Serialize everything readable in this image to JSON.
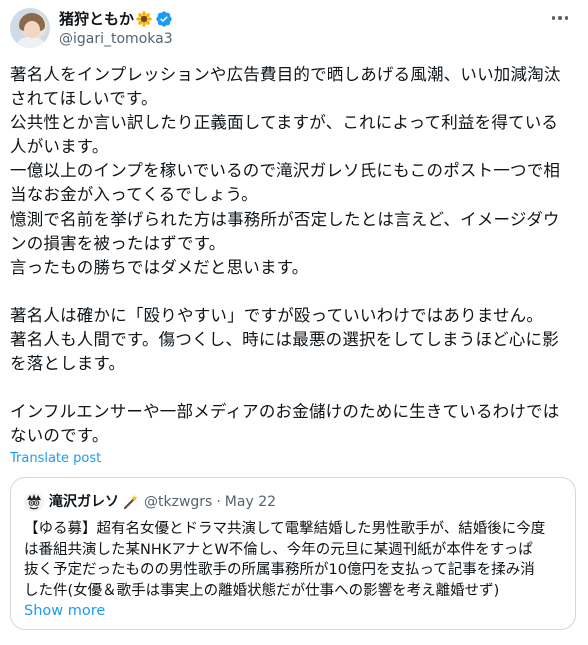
{
  "author": {
    "display_name": "猪狩ともか",
    "handle": "@igari_tomoka3",
    "avatar_icon": "profile-photo",
    "name_emoji_icon": "sunflower-icon",
    "verified_icon": "verified-badge-icon",
    "verified_color": "#1d9bf0"
  },
  "more_icon": "more-options-icon",
  "tweet": {
    "lines": [
      "著名人をインプレッションや広告費目的で晒しあげる風潮、いい加減淘汰",
      "されてほしいです。",
      "公共性とか言い訳したり正義面してますが、これによって利益を得ている",
      "人がいます。",
      "一億以上のインプを稼いでいるので滝沢ガレソ氏にもこのポスト一つで相",
      "当なお金が入ってくるでしょう。",
      "憶測で名前を挙げられた方は事務所が否定したとは言えど、イメージダウ",
      "ンの損害を被ったはずです。",
      "言ったもの勝ちではダメだと思います。",
      "",
      "著名人は確かに「殴りやすい」ですが殴っていいわけではありません。",
      "著名人も人間です。傷つくし、時には最悪の選択をしてしまうほど心に影",
      "を落とします。",
      "",
      "インフルエンサーや一部メディアのお金儲けのために生きているわけでは",
      "ないのです。"
    ]
  },
  "translate_label": "Translate post",
  "link_color": "#1d9bf0",
  "quote": {
    "avatar_icon": "quoted-user-avatar",
    "name": "滝沢ガレソ",
    "name_icon": "wand-icon",
    "handle": "@tkzwgrs",
    "separator": "·",
    "date": "May 22",
    "lines": [
      "【ゆる募】超有名女優とドラマ共演して電撃結婚した男性歌手が、結婚後に今度",
      "は番組共演した某NHKアナとW不倫し、今年の元旦に某週刊紙が本件をすっぱ",
      "抜く予定だったものの男性歌手の所属事務所が10億円を支払って記事を揉み消",
      "した件(女優＆歌手は事実上の離婚状態だが仕事への影響を考え離婚せず)"
    ],
    "show_more_label": "Show more"
  }
}
